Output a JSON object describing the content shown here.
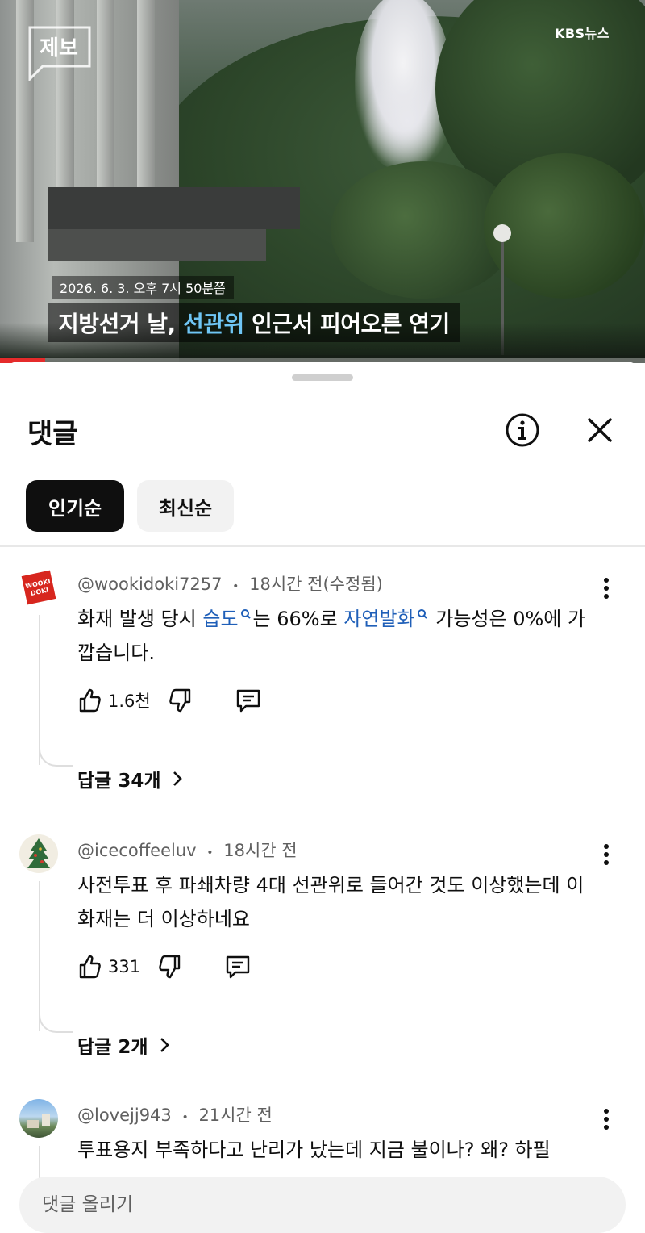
{
  "video": {
    "channel_logo_text": "제보",
    "network_logo": "KBS뉴스",
    "date_caption": "2026. 6. 3. 오후 7시 50분쯤",
    "title_prefix": "지방선거 날, ",
    "title_highlight": "선관위",
    "title_suffix": " 인근서 피어오른 연기",
    "progress_fraction": 0.07,
    "accent_color": "#e52b2b"
  },
  "sheet": {
    "title": "댓글",
    "info_icon": "info-icon",
    "close_icon": "close-icon"
  },
  "sort_chips": [
    {
      "label": "인기순",
      "active": true
    },
    {
      "label": "최신순",
      "active": false
    }
  ],
  "comments": [
    {
      "author": "@wookidoki7257",
      "time": "18시간 전(수정됨)",
      "avatar_text": "WOOKI DOKI",
      "text_parts": {
        "p1": "화재 발생 당시 ",
        "link1": "습도",
        "p2": "는 66%로 ",
        "link2": "자연발화",
        "p3": " 가능성은 0%에 가깝습니다."
      },
      "likes": "1.6천",
      "replies": "답글 34개"
    },
    {
      "author": "@icecoffeeluv",
      "time": "18시간 전",
      "text": "사전투표 후 파쇄차량 4대 선관위로 들어간 것도 이상했는데 이 화재는 더 이상하네요",
      "likes": "331",
      "replies": "답글 2개"
    },
    {
      "author": "@lovejj943",
      "time": "21시간 전",
      "text": "투표용지 부족하다고 난리가 났는데 지금 불이나? 왜? 하필"
    }
  ],
  "meta_separator": "•",
  "input": {
    "placeholder": "댓글 올리기"
  },
  "colors": {
    "link": "#1f5fb8",
    "chip_active_bg": "#0f0f0f",
    "chip_inactive_bg": "#f2f2f2",
    "caption_highlight": "#6fc6f5"
  }
}
